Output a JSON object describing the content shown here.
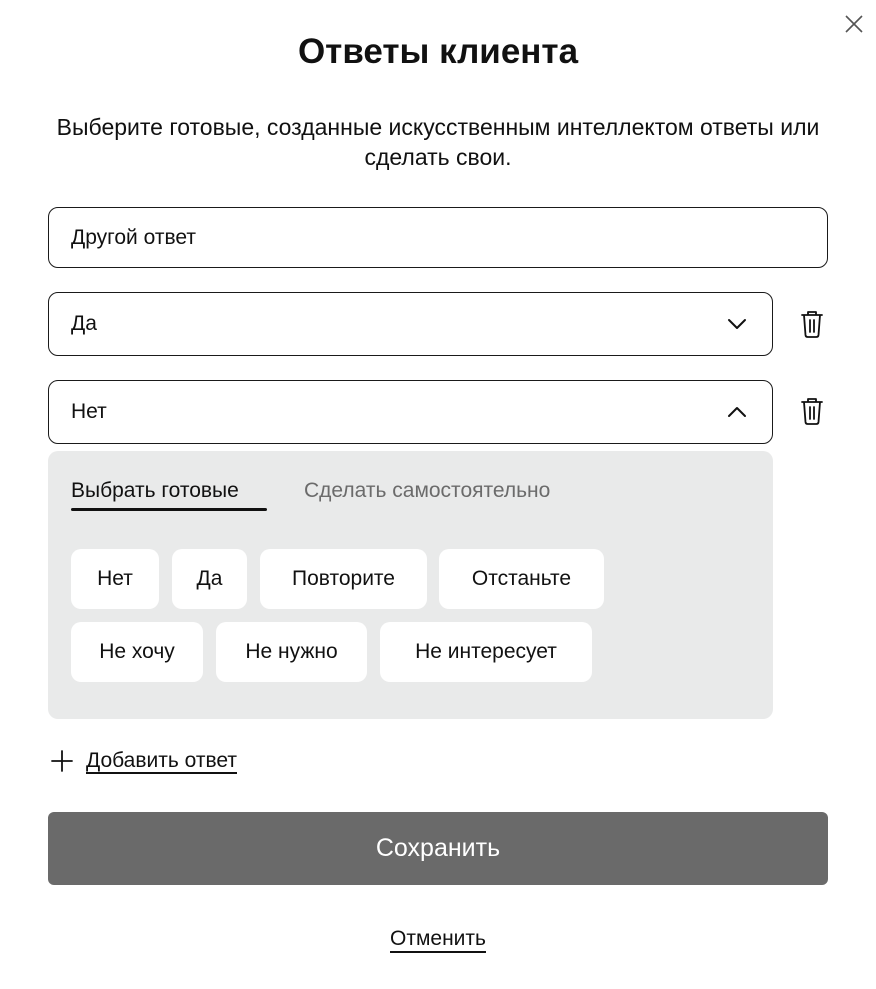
{
  "dialog": {
    "title": "Ответы клиента",
    "subtitle": "Выберите готовые, созданные искусственным интеллектом ответы или сделать свои."
  },
  "answers": [
    {
      "value": "Другой ответ"
    },
    {
      "value": "Да",
      "expanded": false
    },
    {
      "value": "Нет",
      "expanded": true
    }
  ],
  "panel": {
    "tabs": [
      {
        "label": "Выбрать готовые",
        "active": true
      },
      {
        "label": "Сделать самостоятельно",
        "active": false
      }
    ],
    "chips": [
      "Нет",
      "Да",
      "Повторите",
      "Отстаньте",
      "Не хочу",
      "Не нужно",
      "Не интересует"
    ]
  },
  "actions": {
    "add_answer": "Добавить ответ",
    "save": "Сохранить",
    "cancel": "Отменить"
  },
  "icons": {
    "close": "close-icon",
    "chevron_down": "chevron-down-icon",
    "chevron_up": "chevron-up-icon",
    "trash": "trash-icon",
    "plus": "plus-icon"
  },
  "colors": {
    "save_button": "#6a6a6a",
    "panel_background": "#e9eaea",
    "inactive_tab": "#6b6b6b"
  }
}
